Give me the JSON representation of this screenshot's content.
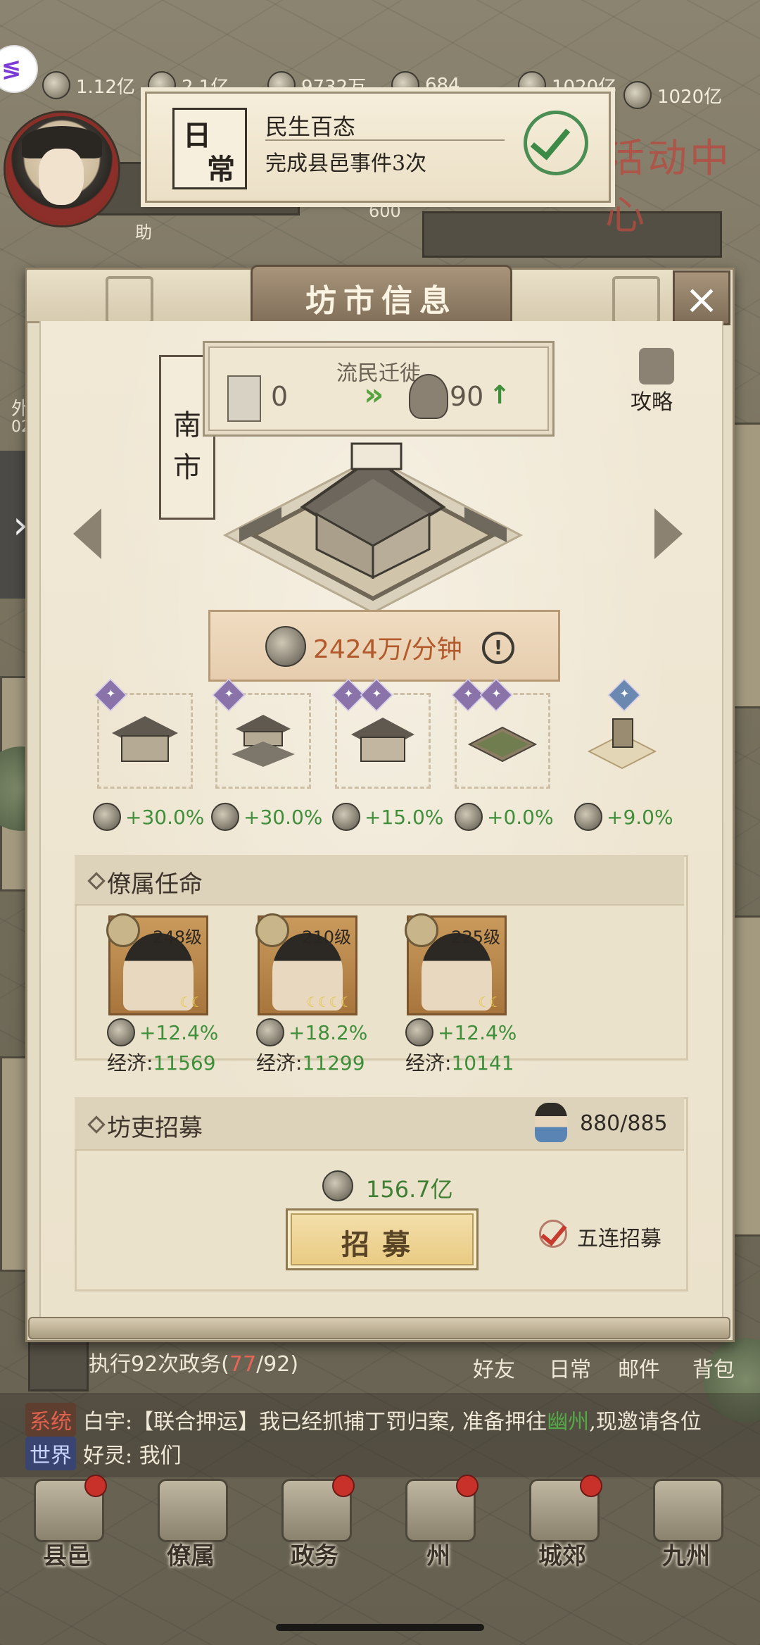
{
  "resources": [
    {
      "name": "silver",
      "value": "1.12亿",
      "icon": "silver-icon"
    },
    {
      "name": "grain",
      "value": "2.1亿",
      "icon": "grain-icon"
    },
    {
      "name": "soldiers",
      "value": "9732万",
      "icon": "soldier-icon"
    },
    {
      "name": "gold",
      "value": "684",
      "icon": "gold-ingot-icon"
    },
    {
      "name": "copper",
      "value": "1020亿",
      "icon": "copper-coin-icon"
    }
  ],
  "avatar_level": "600",
  "avatar_label": "助",
  "side_label_left": "外",
  "side_value_left": "02",
  "daily_task": {
    "tag": "日常",
    "title": "民生百态",
    "desc": "完成县邑事件3次"
  },
  "activity_label": "活动中心",
  "panel": {
    "title": "坊市信息",
    "close_icon": "×",
    "market_name": "南市",
    "migration_title": "流民迁徙",
    "migration_from": "0",
    "migration_to": "90",
    "guide_label": "攻略",
    "income": "2424万/分钟",
    "buildings": [
      {
        "bonus": "+30.0%"
      },
      {
        "bonus": "+30.0%"
      },
      {
        "bonus": "+15.0%"
      },
      {
        "bonus": "+0.0%"
      },
      {
        "bonus": "+9.0%"
      }
    ],
    "staff_title": "僚属任命",
    "staff": [
      {
        "level": "248级",
        "bonus": "+12.4%",
        "econ_label": "经济:",
        "econ": "11569",
        "stars": 2
      },
      {
        "level": "210级",
        "bonus": "+18.2%",
        "econ_label": "经济:",
        "econ": "11299",
        "stars": 4
      },
      {
        "level": "225级",
        "bonus": "+12.4%",
        "econ_label": "经济:",
        "econ": "10141",
        "stars": 2
      }
    ],
    "recruit_title": "坊吏招募",
    "recruit_count": "880/885",
    "recruit_cost": "156.7亿",
    "recruit_button": "招募",
    "five_label": "五连招募"
  },
  "hud": {
    "gov_task_prefix": "执行92次政务(",
    "gov_task_done": "77",
    "gov_task_suffix": "/92)",
    "shortcuts": [
      "好友",
      "日常",
      "邮件",
      "背包"
    ],
    "chat": [
      {
        "channel": "系统",
        "text_a": "白宇:【联合押运】我已经抓捕丁罚归案, 准备押往",
        "loc": "幽州",
        "text_b": ",现邀请各位"
      },
      {
        "channel": "世界",
        "text_a": "好灵: 我们",
        "loc": "",
        "text_b": ""
      }
    ],
    "nav": [
      "县邑",
      "僚属",
      "政务",
      "州",
      "城郊",
      "九州"
    ]
  },
  "colors": {
    "positive_green": "#3f8f3a",
    "income_orange": "#b35a2c",
    "alert_red": "#c8312a"
  }
}
